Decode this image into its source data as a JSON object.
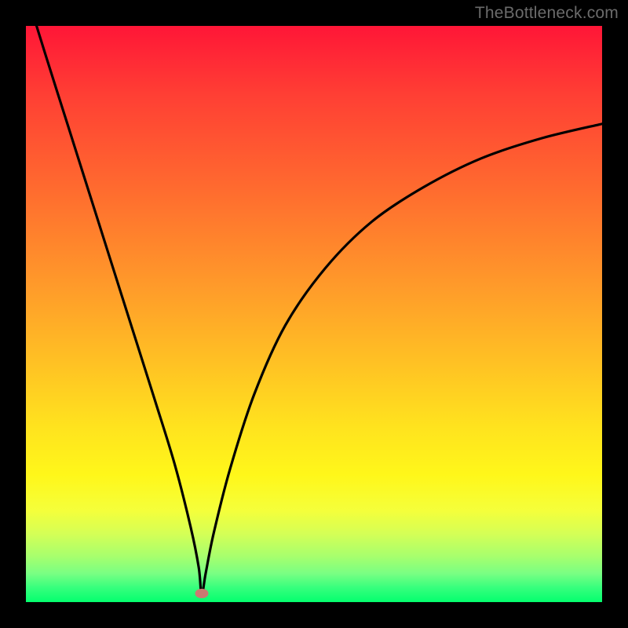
{
  "watermark": "TheBottleneck.com",
  "chart_data": {
    "type": "line",
    "title": "",
    "xlabel": "",
    "ylabel": "",
    "xlim": [
      0,
      1
    ],
    "ylim": [
      0,
      1
    ],
    "grid": false,
    "legend": false,
    "marker": {
      "x": 0.305,
      "y": 0.015,
      "color": "#cb7a71"
    },
    "background_gradient": {
      "top": "#ff1637",
      "mid": "#ffe41e",
      "bottom": "#04ff6e"
    },
    "series": [
      {
        "name": "bottleneck-curve",
        "color": "#000000",
        "x": [
          0.0,
          0.034,
          0.072,
          0.11,
          0.148,
          0.186,
          0.224,
          0.258,
          0.286,
          0.3,
          0.305,
          0.312,
          0.326,
          0.354,
          0.396,
          0.45,
          0.52,
          0.6,
          0.69,
          0.79,
          0.895,
          1.0
        ],
        "y": [
          1.06,
          0.95,
          0.83,
          0.71,
          0.59,
          0.47,
          0.35,
          0.24,
          0.13,
          0.06,
          0.012,
          0.05,
          0.12,
          0.23,
          0.36,
          0.48,
          0.58,
          0.66,
          0.72,
          0.77,
          0.805,
          0.83
        ]
      }
    ]
  }
}
